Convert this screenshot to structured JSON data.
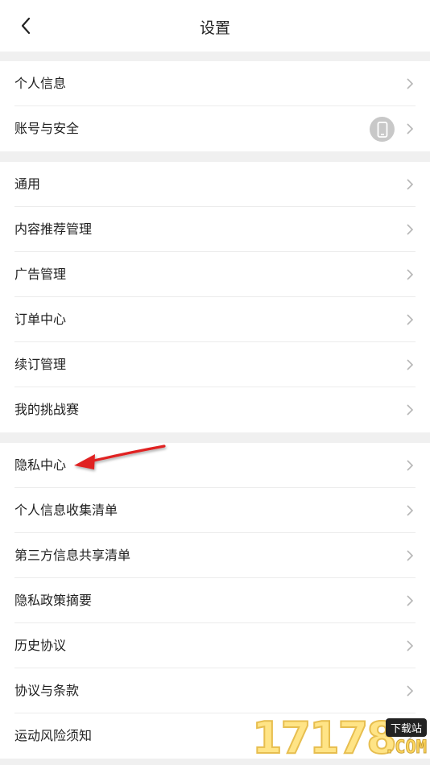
{
  "header": {
    "title": "设置"
  },
  "groups": [
    {
      "items": [
        {
          "label": "个人信息"
        },
        {
          "label": "账号与安全"
        }
      ]
    },
    {
      "items": [
        {
          "label": "通用"
        },
        {
          "label": "内容推荐管理"
        },
        {
          "label": "广告管理"
        },
        {
          "label": "订单中心"
        },
        {
          "label": "续订管理"
        },
        {
          "label": "我的挑战赛"
        }
      ]
    },
    {
      "items": [
        {
          "label": "隐私中心"
        },
        {
          "label": "个人信息收集清单"
        },
        {
          "label": "第三方信息共享清单"
        },
        {
          "label": "隐私政策摘要"
        },
        {
          "label": "历史协议"
        },
        {
          "label": "协议与条款"
        },
        {
          "label": "运动风险须知"
        }
      ]
    }
  ],
  "icons": {
    "back": "chevron-left-icon",
    "row_arrow": "chevron-right-icon",
    "account_badge": "phone-icon"
  },
  "annotation": {
    "type": "red-arrow",
    "color": "#e02020",
    "target": "隐私中心"
  },
  "watermark": {
    "number": "17178",
    "tag": "下载站",
    "suffix": ".COM"
  }
}
